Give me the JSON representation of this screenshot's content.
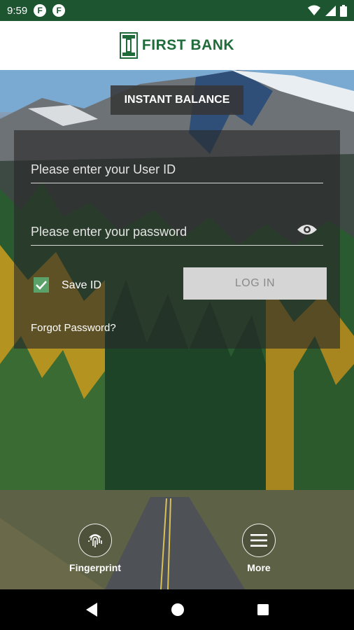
{
  "status_bar": {
    "time": "9:59",
    "app_icons": [
      "F",
      "F"
    ],
    "icons": [
      "wifi-icon",
      "signal-icon",
      "battery-icon"
    ]
  },
  "header": {
    "brand_name": "FIRST BANK",
    "icon": "bank-logo-icon"
  },
  "instant_balance": {
    "label": "INSTANT BALANCE"
  },
  "login": {
    "user_id_placeholder": "Please enter your User ID",
    "password_placeholder": "Please enter your password",
    "password_visibility_icon": "eye-icon",
    "save_id_label": "Save ID",
    "save_id_checked": true,
    "login_button_label": "LOG IN",
    "forgot_password_label": "Forgot Password?"
  },
  "bottom_actions": {
    "fingerprint_label": "Fingerprint",
    "fingerprint_icon": "fingerprint-icon",
    "more_label": "More",
    "more_icon": "hamburger-menu-icon"
  },
  "nav_bar": {
    "icons": [
      "back-icon",
      "home-icon",
      "recents-icon"
    ]
  },
  "colors": {
    "brand_green": "#1f6b3a",
    "status_bar": "#1c5530",
    "checkbox_green": "#5ba26a"
  }
}
